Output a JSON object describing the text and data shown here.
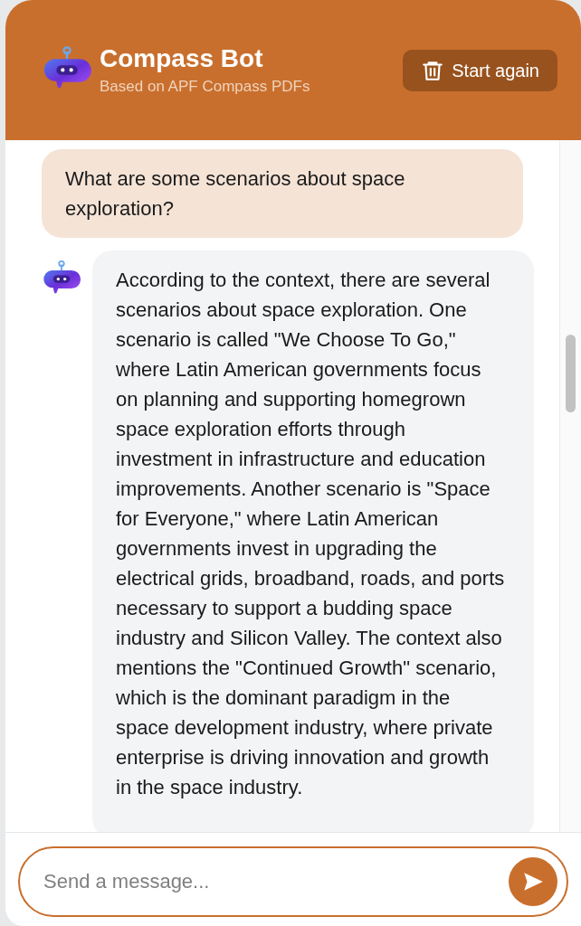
{
  "header": {
    "title": "Compass Bot",
    "subtitle": "Based on APF Compass PDFs",
    "reset_button": "Start again"
  },
  "messages": [
    {
      "kind": "user",
      "text": "What are some scenarios about space exploration?"
    },
    {
      "kind": "bot",
      "text": "According to the context, there are several scenarios about space exploration. One scenario is called \"We Choose To Go,\" where Latin American governments focus on planning and supporting homegrown space exploration efforts through investment in infrastructure and education improvements. Another scenario is \"Space for Everyone,\" where Latin American governments invest in upgrading the electrical grids, broadband, roads, and ports necessary to support a budding space industry and Silicon Valley. The context also mentions the \"Continued Growth\" scenario, which is the dominant paradigm in the space development industry, where private enterprise is driving innovation and growth in the space industry."
    }
  ],
  "composer": {
    "placeholder": "Send a message..."
  }
}
